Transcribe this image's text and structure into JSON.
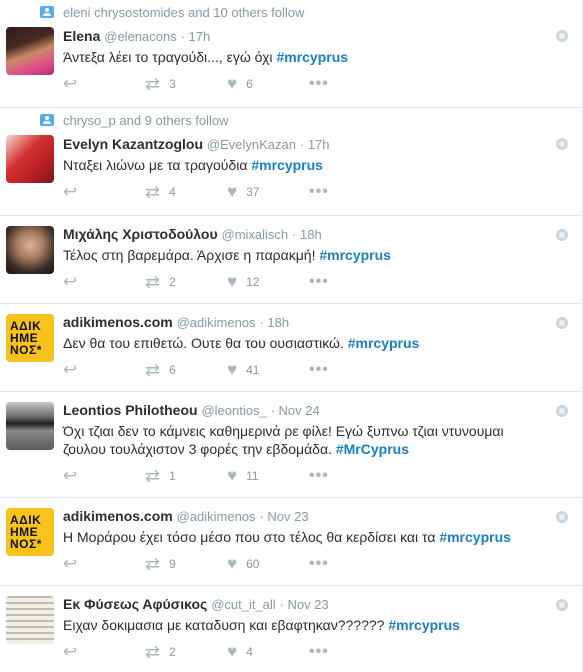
{
  "tweets": [
    {
      "context": "eleni chrysostomides and 10 others follow",
      "avatar_style": "photo-woman-pink",
      "fullname": "Elena",
      "handle": "@elenacons",
      "time": "· 17h",
      "text_plain": "Άντεξα λέει το τραγούδι..., εγώ όχι ",
      "hashtag": "#mrcyprus",
      "retweets": "3",
      "likes": "6"
    },
    {
      "context": "chryso_p and 9 others follow",
      "avatar_style": "photo-red",
      "fullname": "Evelyn Kazantzoglou",
      "handle": "@EvelynKazan",
      "time": "· 17h",
      "text_plain": "Νταξει λιώνω με τα τραγούδια ",
      "hashtag": "#mrcyprus",
      "retweets": "4",
      "likes": "37"
    },
    {
      "context": "",
      "avatar_style": "photo-man-bald",
      "fullname": "Μιχάλης Χριστοδούλου",
      "handle": "@mixalisch",
      "time": "· 18h",
      "text_plain": "Τέλος στη βαρεμάρα. Άρχισε η παρακμή! ",
      "hashtag": "#mrcyprus",
      "retweets": "2",
      "likes": "12"
    },
    {
      "context": "",
      "avatar_style": "logo",
      "avatar_text": [
        "ΑΔΙΚ",
        "ΗΜΕ",
        "ΝΟΣ*"
      ],
      "fullname": "adikimenos.com",
      "handle": "@adikimenos",
      "time": "· 18h",
      "text_plain": "Δεν θα του επιθετώ. Ουτε θα του ουσιαστικώ. ",
      "hashtag": "#mrcyprus",
      "retweets": "6",
      "likes": "41"
    },
    {
      "context": "",
      "avatar_style": "photo-man-sunglasses",
      "fullname": "Leontios Philotheou",
      "handle": "@leontios_",
      "time": "· Nov 24",
      "text_plain": "Όχι τζιαι δεν το κάμνεις καθημερινά ρε φίλε! Εγώ ξυπνω τζιαι ντυνουμαι ζουλου τουλάχιστον 3 φορές την εβδομάδα. ",
      "hashtag": "#MrCyprus",
      "retweets": "1",
      "likes": "11"
    },
    {
      "context": "",
      "avatar_style": "logo",
      "avatar_text": [
        "ΑΔΙΚ",
        "ΗΜΕ",
        "ΝΟΣ*"
      ],
      "fullname": "adikimenos.com",
      "handle": "@adikimenos",
      "time": "· Nov 23",
      "text_plain": "Η Μοράρου έχει τόσο μέσο που στο τέλος θα κερδίσει και τα ",
      "hashtag": "#mrcyprus",
      "retweets": "9",
      "likes": "60"
    },
    {
      "context": "",
      "avatar_style": "photo-paper",
      "fullname": "Εκ Φύσεως Αφύσικος",
      "handle": "@cut_it_all",
      "time": "· Nov 23",
      "text_plain": "Ειχαν δοκιμασια με καταδυση και εβαφτηκαν?????? ",
      "hashtag": "#mrcyprus",
      "retweets": "2",
      "likes": "4"
    }
  ],
  "icons": {
    "reply": "reply-icon",
    "retweet": "retweet-icon",
    "like": "heart-icon",
    "more": "more-icon",
    "follow_context": "follow-context-icon",
    "globe": "globe-icon"
  },
  "colors": {
    "hashtag": "#1b7fc7",
    "muted": "#8899a6",
    "icon": "#aab8c2",
    "logo_bg": "#f7c21b"
  }
}
